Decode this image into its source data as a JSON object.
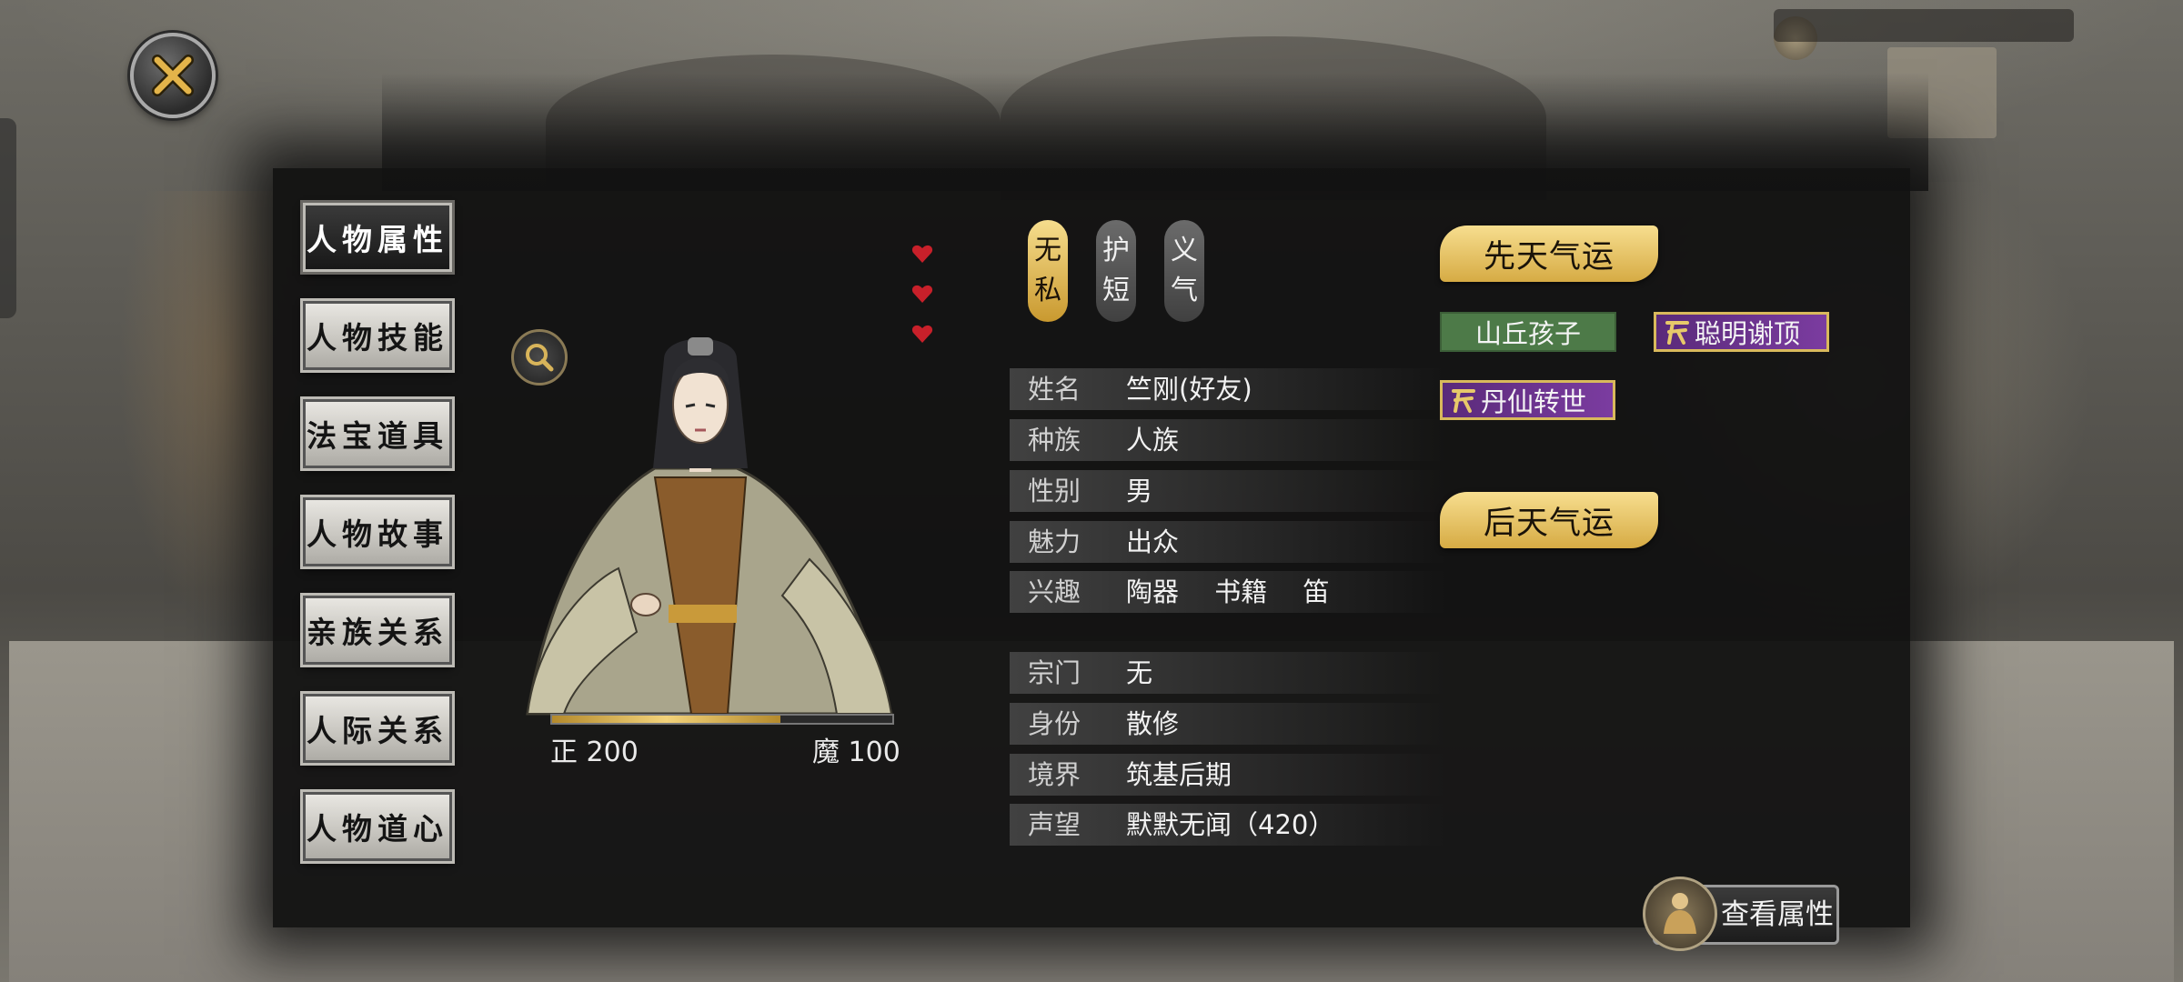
{
  "window": {
    "close_icon": "close-x-icon"
  },
  "tabs": [
    {
      "label": "人物属性",
      "active": true
    },
    {
      "label": "人物技能",
      "active": false
    },
    {
      "label": "法宝道具",
      "active": false
    },
    {
      "label": "人物故事",
      "active": false
    },
    {
      "label": "亲族关系",
      "active": false
    },
    {
      "label": "人际关系",
      "active": false
    },
    {
      "label": "人物道心",
      "active": false
    }
  ],
  "portrait": {
    "zoom_icon": "magnifier-icon",
    "alignment": {
      "righteous_label": "正 200",
      "demonic_label": "魔 100",
      "righteous_fraction": 0.67
    }
  },
  "traits": [
    {
      "chars": [
        "无",
        "私"
      ],
      "style": "gold"
    },
    {
      "chars": [
        "护",
        "短"
      ],
      "style": "grey"
    },
    {
      "chars": [
        "义",
        "气"
      ],
      "style": "grey"
    }
  ],
  "hearts": {
    "count": 3,
    "color": "#c8202a"
  },
  "info": {
    "basic": [
      {
        "label": "姓名",
        "value": "竺刚(好友)"
      },
      {
        "label": "种族",
        "value": "人族"
      },
      {
        "label": "性别",
        "value": "男"
      },
      {
        "label": "魅力",
        "value": "出众"
      }
    ],
    "hobby_label": "兴趣",
    "hobbies": [
      "陶器",
      "书籍",
      "笛"
    ],
    "status": [
      {
        "label": "宗门",
        "value": "无"
      },
      {
        "label": "身份",
        "value": "散修"
      },
      {
        "label": "境界",
        "value": "筑基后期"
      },
      {
        "label": "声望",
        "value": "默默无闻（420）"
      }
    ]
  },
  "fortune": {
    "innate_header": "先天气运",
    "innate_tags": [
      {
        "label": "山丘孩子",
        "style": "green"
      },
      {
        "label": "聪明谢顶",
        "style": "purple"
      },
      {
        "label": "丹仙转世",
        "style": "purple"
      }
    ],
    "acquired_header": "后天气运"
  },
  "view_attributes_button": "查看属性",
  "colors": {
    "gold": "#e9c767",
    "panel": "#101010",
    "green_tag": "#4d7a48",
    "purple_tag": "#6a338c"
  }
}
